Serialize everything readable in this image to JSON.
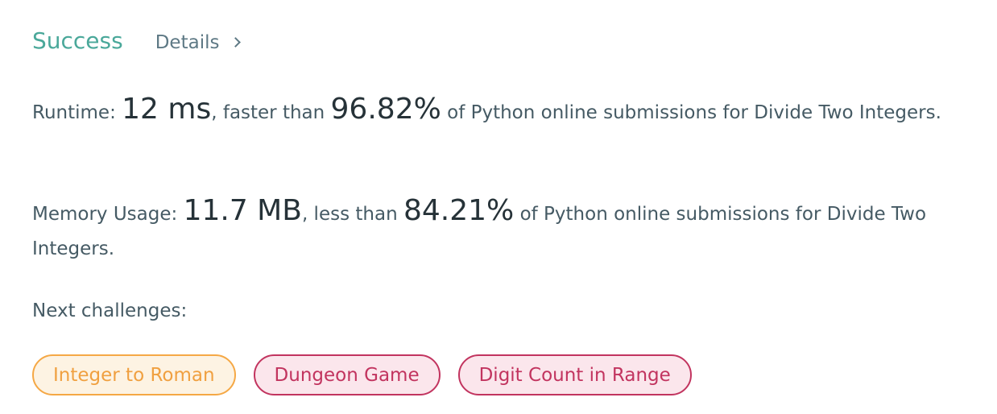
{
  "header": {
    "status": "Success",
    "details_label": "Details"
  },
  "runtime": {
    "label": "Runtime:",
    "value": "12 ms",
    "comparison": ", faster than",
    "percent": "96.82%",
    "tail": "of Python online submissions for Divide Two Integers."
  },
  "memory": {
    "label": "Memory Usage:",
    "value": "11.7 MB",
    "comparison": ", less than",
    "percent": "84.21%",
    "tail": "of Python online submissions for Divide Two Integers."
  },
  "next": {
    "title": "Next challenges:",
    "challenges": [
      {
        "label": "Integer to Roman",
        "difficulty_color": "#f5a845"
      },
      {
        "label": "Dungeon Game",
        "difficulty_color": "#c2345f"
      },
      {
        "label": "Digit Count in Range",
        "difficulty_color": "#c2345f"
      }
    ]
  },
  "colors": {
    "success": "#4aa89a",
    "medium": "#f5a845",
    "hard": "#c2345f"
  }
}
